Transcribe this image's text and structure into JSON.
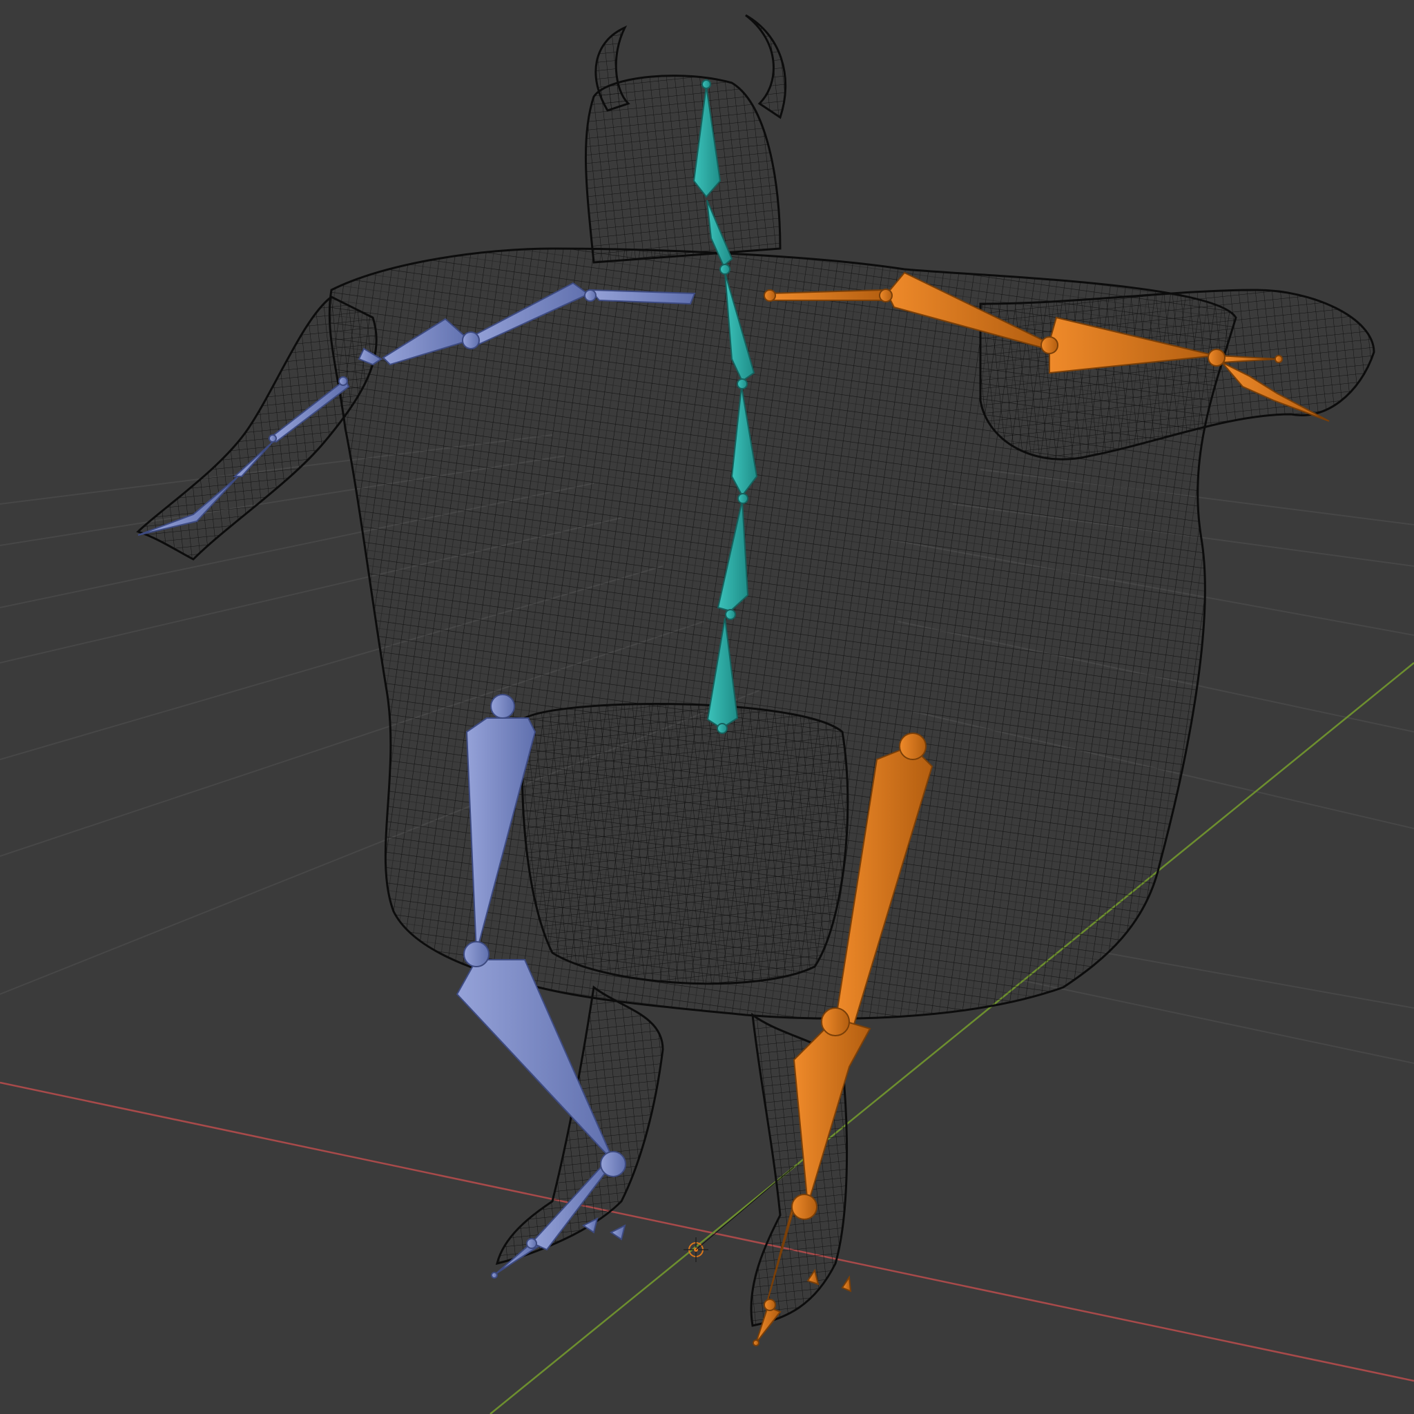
{
  "app": {
    "title": ""
  },
  "viewport": {
    "background": "#3b3b3b",
    "grid_color": "#454545",
    "x_axis_color": "#a84a4a",
    "y_axis_color": "#6d8f2f"
  },
  "scene": {
    "mesh": {
      "name": "",
      "wire_color": "#0c0c0c"
    },
    "armature": {
      "colors": {
        "spine": "#2fa9a2",
        "left_side": "#7a88c4",
        "right_side": "#d9771c"
      },
      "bones": [
        {
          "group": "spine",
          "name": ""
        },
        {
          "group": "left_side",
          "name": ""
        },
        {
          "group": "right_side",
          "name": ""
        }
      ]
    },
    "icons": {
      "origin": "origin-cursor-icon"
    }
  }
}
